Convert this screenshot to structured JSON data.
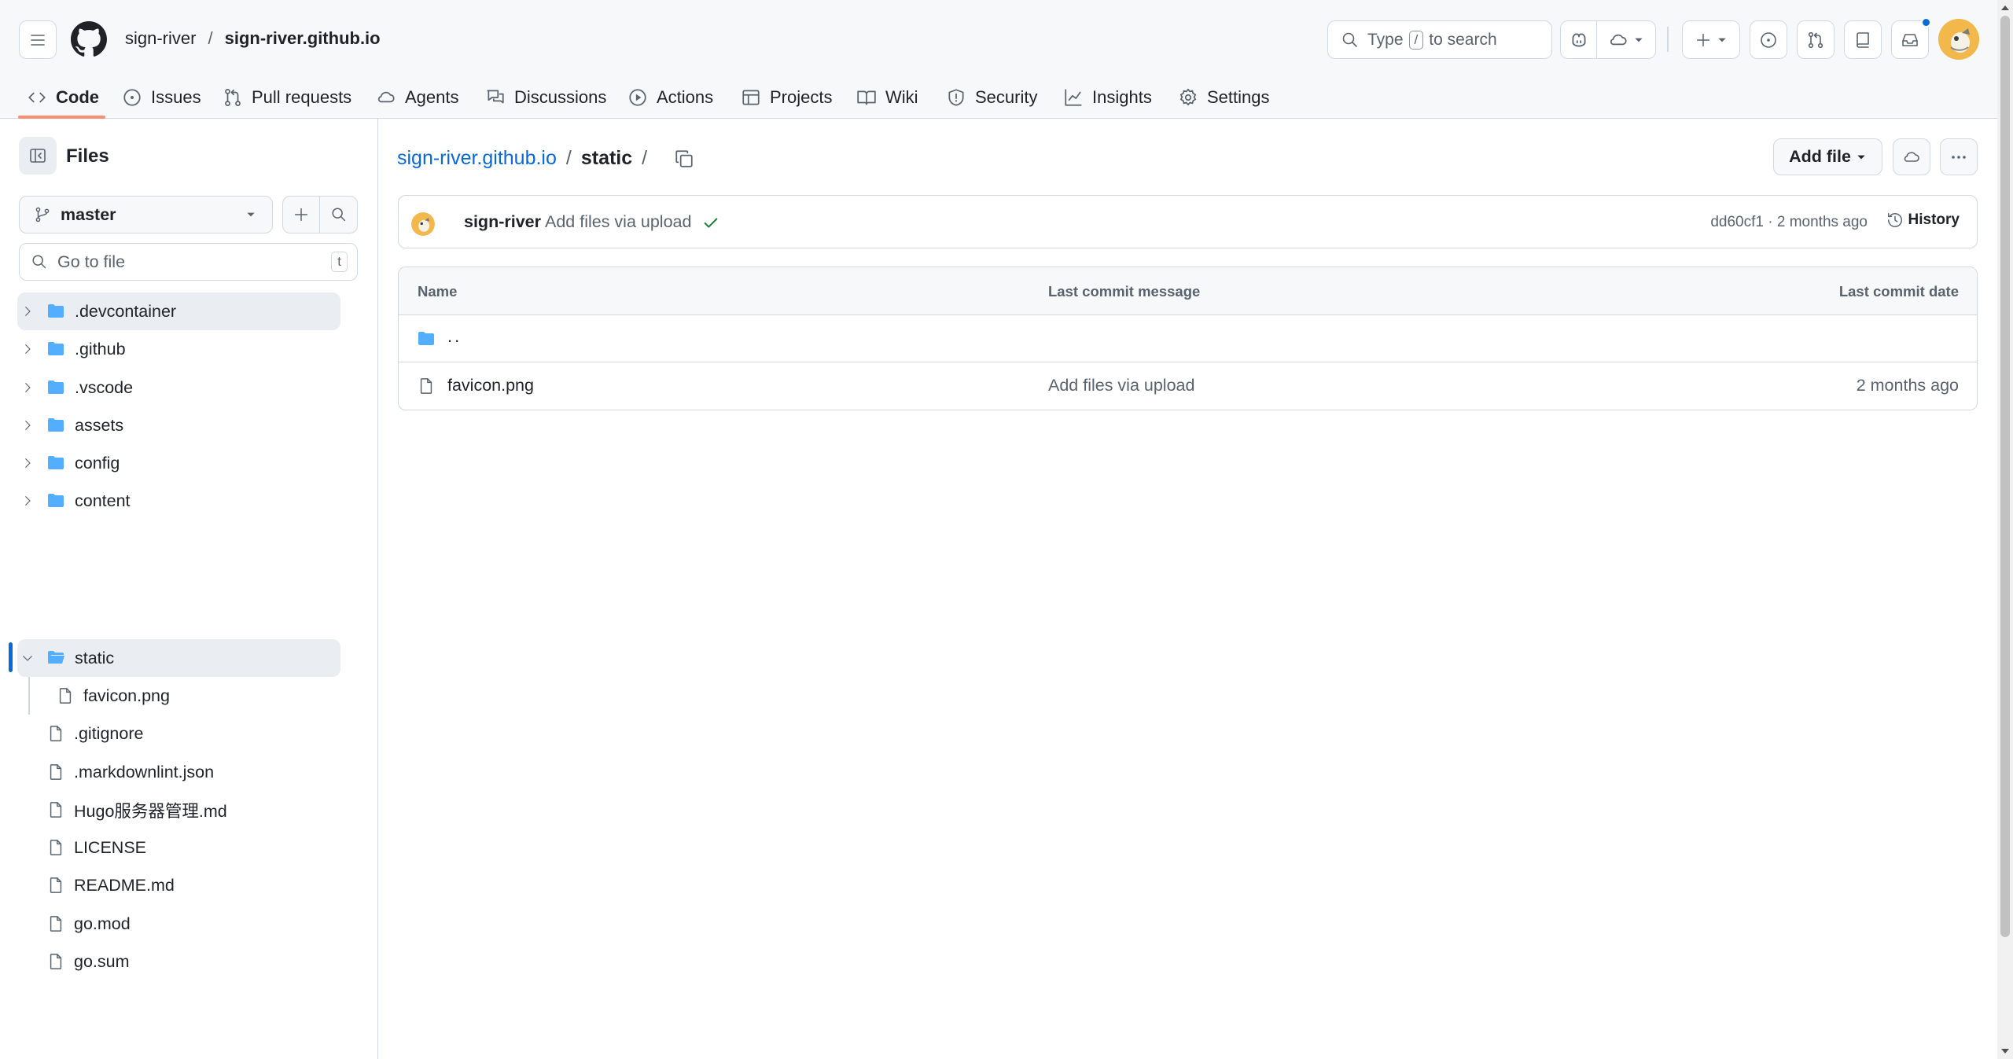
{
  "repo": {
    "owner": "sign-river",
    "separator": "/",
    "name": "sign-river.github.io"
  },
  "search": {
    "type_label": "Type",
    "slash_key": "/",
    "to_search_label": "to search"
  },
  "tabs": [
    {
      "label": "Code",
      "icon": "code-icon"
    },
    {
      "label": "Issues",
      "icon": "issue-icon"
    },
    {
      "label": "Pull requests",
      "icon": "pull-request-icon"
    },
    {
      "label": "Agents",
      "icon": "agents-icon"
    },
    {
      "label": "Discussions",
      "icon": "discussions-icon"
    },
    {
      "label": "Actions",
      "icon": "actions-icon"
    },
    {
      "label": "Projects",
      "icon": "projects-icon"
    },
    {
      "label": "Wiki",
      "icon": "wiki-icon"
    },
    {
      "label": "Security",
      "icon": "shield-icon"
    },
    {
      "label": "Insights",
      "icon": "graph-icon"
    },
    {
      "label": "Settings",
      "icon": "gear-icon"
    }
  ],
  "sidebar": {
    "title": "Files",
    "branch": "master",
    "go_to_file_placeholder": "Go to file",
    "go_to_file_key": "t",
    "tree": [
      {
        "name": ".devcontainer",
        "type": "dir",
        "expanded": false,
        "selected": false
      },
      {
        "name": ".github",
        "type": "dir",
        "expanded": false,
        "selected": false
      },
      {
        "name": ".vscode",
        "type": "dir",
        "expanded": false,
        "selected": false
      },
      {
        "name": "assets",
        "type": "dir",
        "expanded": false,
        "selected": false
      },
      {
        "name": "config",
        "type": "dir",
        "expanded": false,
        "selected": false
      },
      {
        "name": "content",
        "type": "dir",
        "expanded": false,
        "selected": false
      },
      {
        "name": "static",
        "type": "dir",
        "expanded": true,
        "selected": true
      },
      {
        "name": "favicon.png",
        "type": "file",
        "child": true
      },
      {
        "name": ".gitignore",
        "type": "file"
      },
      {
        "name": ".markdownlint.json",
        "type": "file"
      },
      {
        "name": "Hugo服务器管理.md",
        "type": "file"
      },
      {
        "name": "LICENSE",
        "type": "file"
      },
      {
        "name": "README.md",
        "type": "file"
      },
      {
        "name": "go.mod",
        "type": "file"
      },
      {
        "name": "go.sum",
        "type": "file"
      }
    ]
  },
  "breadcrumb": {
    "repo": "sign-river.github.io",
    "sep": "/",
    "folder": "static",
    "trailing": "/"
  },
  "add_file_label": "Add file",
  "commit": {
    "author": "sign-river",
    "message": "Add files via upload",
    "sha_time": "dd60cf1 · 2 months ago",
    "history_label": "History"
  },
  "table": {
    "headers": {
      "name": "Name",
      "message": "Last commit message",
      "date": "Last commit date"
    },
    "parent_label": "..",
    "rows": [
      {
        "name": "favicon.png",
        "message": "Add files via upload",
        "date": "2 months ago"
      }
    ]
  },
  "colors": {
    "accent_link": "#0969da",
    "folder": "#54aeff",
    "success": "#1a7f37",
    "tab_underline": "#fd8c73",
    "notification_dot": "#0969da"
  }
}
